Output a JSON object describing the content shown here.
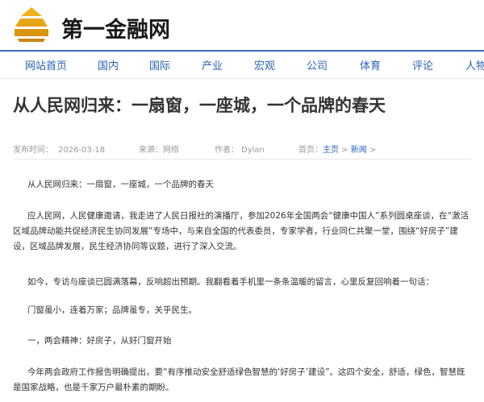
{
  "site": {
    "logo_text": "第一金融网",
    "logo_icon": "stacked-bars-logo-icon",
    "brand_color": "#e8a418"
  },
  "nav": {
    "items": [
      "网站首页",
      "国内",
      "国际",
      "产业",
      "宏观",
      "公司",
      "体育",
      "评论",
      "人物"
    ]
  },
  "article": {
    "title": "从人民网归来：一扇窗，一座城，一个品牌的春天",
    "meta": {
      "publish_label": "发布时间：",
      "publish_time": "2026-03-18",
      "source_label": "来源：",
      "source": "网络",
      "author_label": "作者：",
      "author": "Dylan",
      "breadcrumb_label": "首页：",
      "breadcrumb_home": "主页",
      "breadcrumb_sep": " > ",
      "breadcrumb_section": "新闻",
      "breadcrumb_trail": " >"
    },
    "paragraphs": [
      "从人民网归来：一扇窗，一座城，一个品牌的春天",
      "应人民网，人民健康邀请，我走进了人民日报社的演播厅，参加2026年全国两会“健康中国人”系列圆桌座谈，在“激活区域品牌动能共促经济民生协同发展”专场中，与来自全国的代表委员，专家学者，行业同仁共聚一堂，围绕“好房子”建设，区域品牌发展，民生经济协同等议题，进行了深入交流。",
      "如今，专访与座谈已圆满落幕，反响超出预期。我翻看着手机里一条条温暖的留言，心里反复回响着一句话：",
      "门窗虽小，连着万家；品牌虽专，关乎民生。",
      "一，两会精神：好房子，从好门窗开始",
      "今年两会政府工作报告明确提出，要“有序推动安全舒适绿色智慧的‘好房子’建设”。这四个安全，舒适，绿色，智慧既是国家战略，也是千家万户最朴素的期盼。"
    ]
  },
  "colors": {
    "nav_text": "#2a64b3",
    "nav_border": "#3a6fb8",
    "meta_text": "#999999",
    "link": "#2a64b3"
  }
}
